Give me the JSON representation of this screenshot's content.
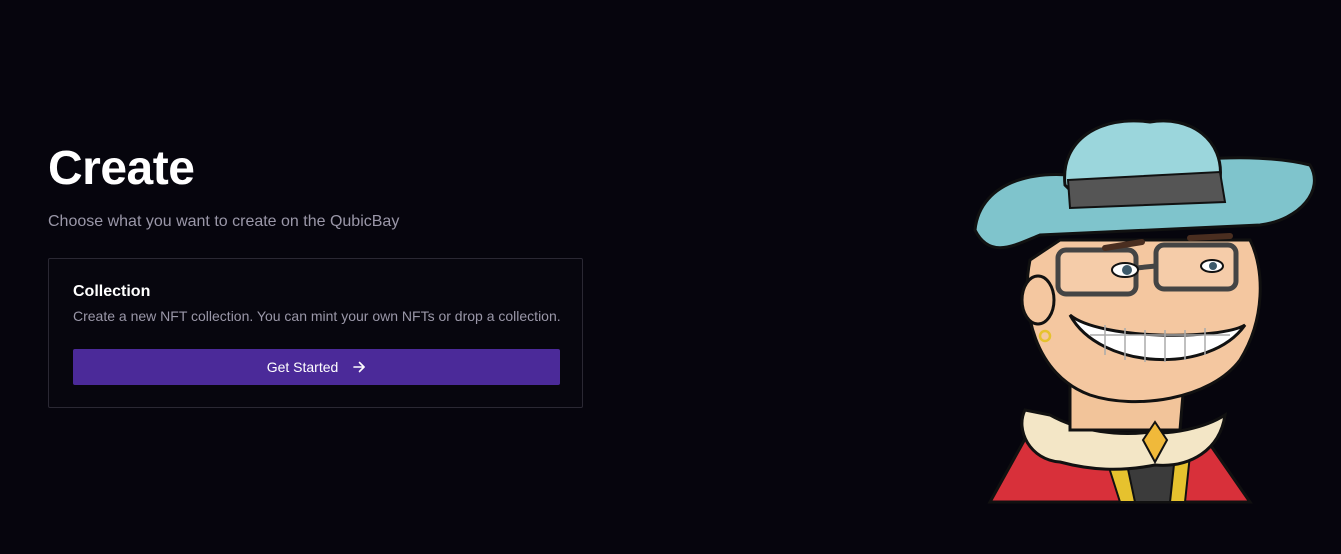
{
  "page": {
    "title": "Create",
    "subtitle": "Choose what you want to create on the QubicBay"
  },
  "card": {
    "title": "Collection",
    "description": "Create a new NFT collection. You can mint your own NFTs or drop a collection.",
    "button_label": "Get Started",
    "button_icon": "arrow-right-icon"
  },
  "hero": {
    "image": "cowboy-mascot-illustration"
  },
  "colors": {
    "background": "#06050d",
    "accent": "#4b2a99",
    "muted_text": "#9a97a8",
    "card_border": "#2a2833"
  }
}
